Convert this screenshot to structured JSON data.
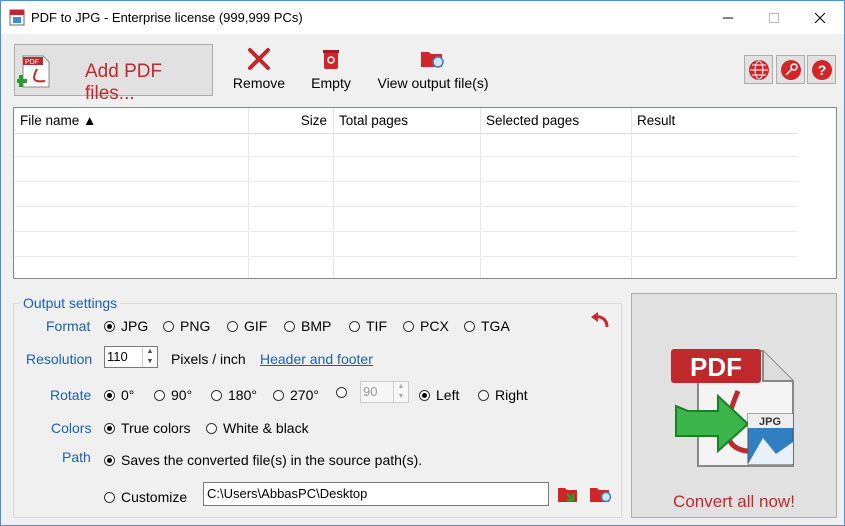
{
  "window": {
    "title": "PDF to JPG - Enterprise license (999,999 PCs)"
  },
  "toolbar": {
    "add_label": "Add PDF files...",
    "remove_label": "Remove",
    "empty_label": "Empty",
    "view_label": "View output file(s)"
  },
  "grid": {
    "columns": [
      "File name ▲",
      "Size",
      "Total pages",
      "Selected pages",
      "Result"
    ]
  },
  "settings": {
    "legend": "Output settings",
    "format_label": "Format",
    "formats": [
      "JPG",
      "PNG",
      "GIF",
      "BMP",
      "TIF",
      "PCX",
      "TGA"
    ],
    "selected_format": "JPG",
    "resolution_label": "Resolution",
    "resolution_value": "110",
    "resolution_unit": "Pixels / inch",
    "header_footer_link": "Header and footer",
    "rotate_label": "Rotate",
    "rotate_options": [
      "0°",
      "90°",
      "180°",
      "270°"
    ],
    "rotate_custom_value": "90",
    "rotate_dir": [
      "Left",
      "Right"
    ],
    "colors_label": "Colors",
    "color_options": [
      "True colors",
      "White & black"
    ],
    "path_label": "Path",
    "path_source_option": "Saves the converted file(s) in the source path(s).",
    "customize_option": "Customize",
    "customize_path": "C:\\Users\\AbbasPC\\Desktop"
  },
  "convert": {
    "label": "Convert all now!",
    "logo_pdf": "PDF",
    "logo_jpg": "JPG"
  },
  "colors": {
    "accent_red": "#c0292b",
    "label_blue": "#1a5fb4"
  }
}
